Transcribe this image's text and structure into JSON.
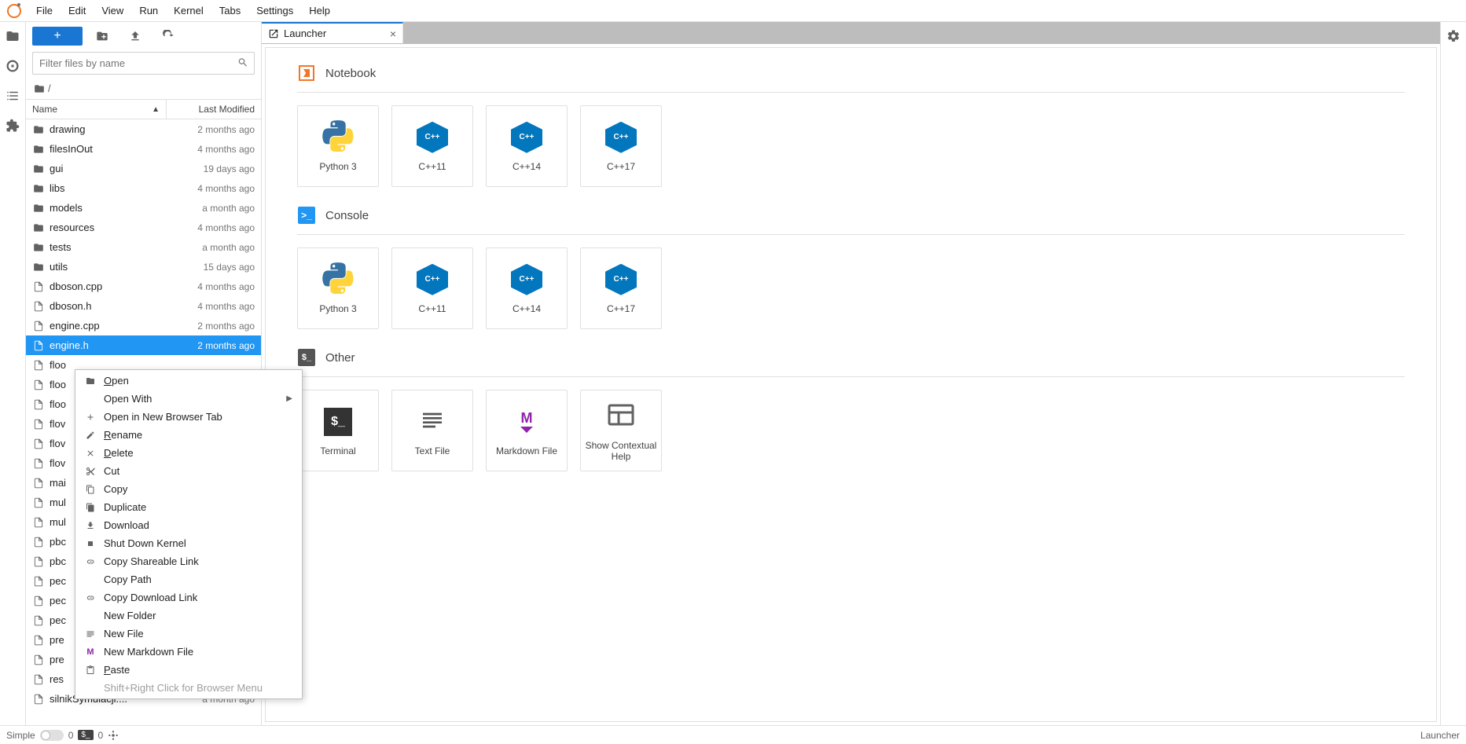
{
  "menu": {
    "items": [
      "File",
      "Edit",
      "View",
      "Run",
      "Kernel",
      "Tabs",
      "Settings",
      "Help"
    ]
  },
  "filebrowser": {
    "filter_placeholder": "Filter files by name",
    "breadcrumb_root": "/",
    "columns": {
      "name": "Name",
      "modified": "Last Modified"
    },
    "rows": [
      {
        "name": "drawing",
        "type": "folder",
        "modified": "2 months ago"
      },
      {
        "name": "filesInOut",
        "type": "folder",
        "modified": "4 months ago"
      },
      {
        "name": "gui",
        "type": "folder",
        "modified": "19 days ago"
      },
      {
        "name": "libs",
        "type": "folder",
        "modified": "4 months ago"
      },
      {
        "name": "models",
        "type": "folder",
        "modified": "a month ago"
      },
      {
        "name": "resources",
        "type": "folder",
        "modified": "4 months ago"
      },
      {
        "name": "tests",
        "type": "folder",
        "modified": "a month ago"
      },
      {
        "name": "utils",
        "type": "folder",
        "modified": "15 days ago"
      },
      {
        "name": "dboson.cpp",
        "type": "file",
        "modified": "4 months ago"
      },
      {
        "name": "dboson.h",
        "type": "file",
        "modified": "4 months ago"
      },
      {
        "name": "engine.cpp",
        "type": "file",
        "modified": "2 months ago"
      },
      {
        "name": "engine.h",
        "type": "file",
        "modified": "2 months ago",
        "selected": true
      },
      {
        "name": "floo",
        "type": "file",
        "modified": ""
      },
      {
        "name": "floo",
        "type": "file",
        "modified": ""
      },
      {
        "name": "floo",
        "type": "file",
        "modified": ""
      },
      {
        "name": "flov",
        "type": "file",
        "modified": ""
      },
      {
        "name": "flov",
        "type": "file",
        "modified": ""
      },
      {
        "name": "flov",
        "type": "file",
        "modified": ""
      },
      {
        "name": "mai",
        "type": "file",
        "modified": ""
      },
      {
        "name": "mul",
        "type": "file",
        "modified": ""
      },
      {
        "name": "mul",
        "type": "file",
        "modified": ""
      },
      {
        "name": "pbc",
        "type": "file",
        "modified": ""
      },
      {
        "name": "pbc",
        "type": "file",
        "modified": ""
      },
      {
        "name": "pec",
        "type": "file",
        "modified": ""
      },
      {
        "name": "pec",
        "type": "file",
        "modified": ""
      },
      {
        "name": "pec",
        "type": "file",
        "modified": ""
      },
      {
        "name": "pre",
        "type": "file",
        "modified": ""
      },
      {
        "name": "pre",
        "type": "file",
        "modified": ""
      },
      {
        "name": "res",
        "type": "file",
        "modified": ""
      },
      {
        "name": "silnikSymulacji....",
        "type": "file",
        "modified": "a month ago"
      }
    ]
  },
  "tab": {
    "title": "Launcher"
  },
  "launcher": {
    "sections": [
      {
        "title": "Notebook",
        "icon": "notebook",
        "cards": [
          {
            "label": "Python 3",
            "icon": "python"
          },
          {
            "label": "C++11",
            "icon": "cpp"
          },
          {
            "label": "C++14",
            "icon": "cpp"
          },
          {
            "label": "C++17",
            "icon": "cpp"
          }
        ]
      },
      {
        "title": "Console",
        "icon": "console",
        "cards": [
          {
            "label": "Python 3",
            "icon": "python"
          },
          {
            "label": "C++11",
            "icon": "cpp"
          },
          {
            "label": "C++14",
            "icon": "cpp"
          },
          {
            "label": "C++17",
            "icon": "cpp"
          }
        ]
      },
      {
        "title": "Other",
        "icon": "other",
        "cards": [
          {
            "label": "Terminal",
            "icon": "terminal"
          },
          {
            "label": "Text File",
            "icon": "text"
          },
          {
            "label": "Markdown File",
            "icon": "markdown"
          },
          {
            "label": "Show Contextual Help",
            "icon": "help"
          }
        ]
      }
    ]
  },
  "context_menu": {
    "items": [
      {
        "icon": "folder",
        "label": "Open",
        "u": 0
      },
      {
        "icon": "",
        "label": "Open With",
        "submenu": true
      },
      {
        "icon": "plus",
        "label": "Open in New Browser Tab"
      },
      {
        "icon": "edit",
        "label": "Rename",
        "u": 0
      },
      {
        "icon": "close",
        "label": "Delete",
        "u": 0
      },
      {
        "icon": "cut",
        "label": "Cut"
      },
      {
        "icon": "copy",
        "label": "Copy"
      },
      {
        "icon": "duplicate",
        "label": "Duplicate"
      },
      {
        "icon": "download",
        "label": "Download"
      },
      {
        "icon": "stop",
        "label": "Shut Down Kernel"
      },
      {
        "icon": "link",
        "label": "Copy Shareable Link"
      },
      {
        "icon": "",
        "label": "Copy Path"
      },
      {
        "icon": "link",
        "label": "Copy Download Link"
      },
      {
        "icon": "",
        "label": "New Folder"
      },
      {
        "icon": "file",
        "label": "New File"
      },
      {
        "icon": "md",
        "label": "New Markdown File"
      },
      {
        "icon": "paste",
        "label": "Paste",
        "u": 0
      },
      {
        "icon": "",
        "label": "Shift+Right Click for Browser Menu",
        "disabled": true
      }
    ]
  },
  "statusbar": {
    "simple": "Simple",
    "term_count": "0",
    "kernel_count": "0",
    "right": "Launcher"
  }
}
